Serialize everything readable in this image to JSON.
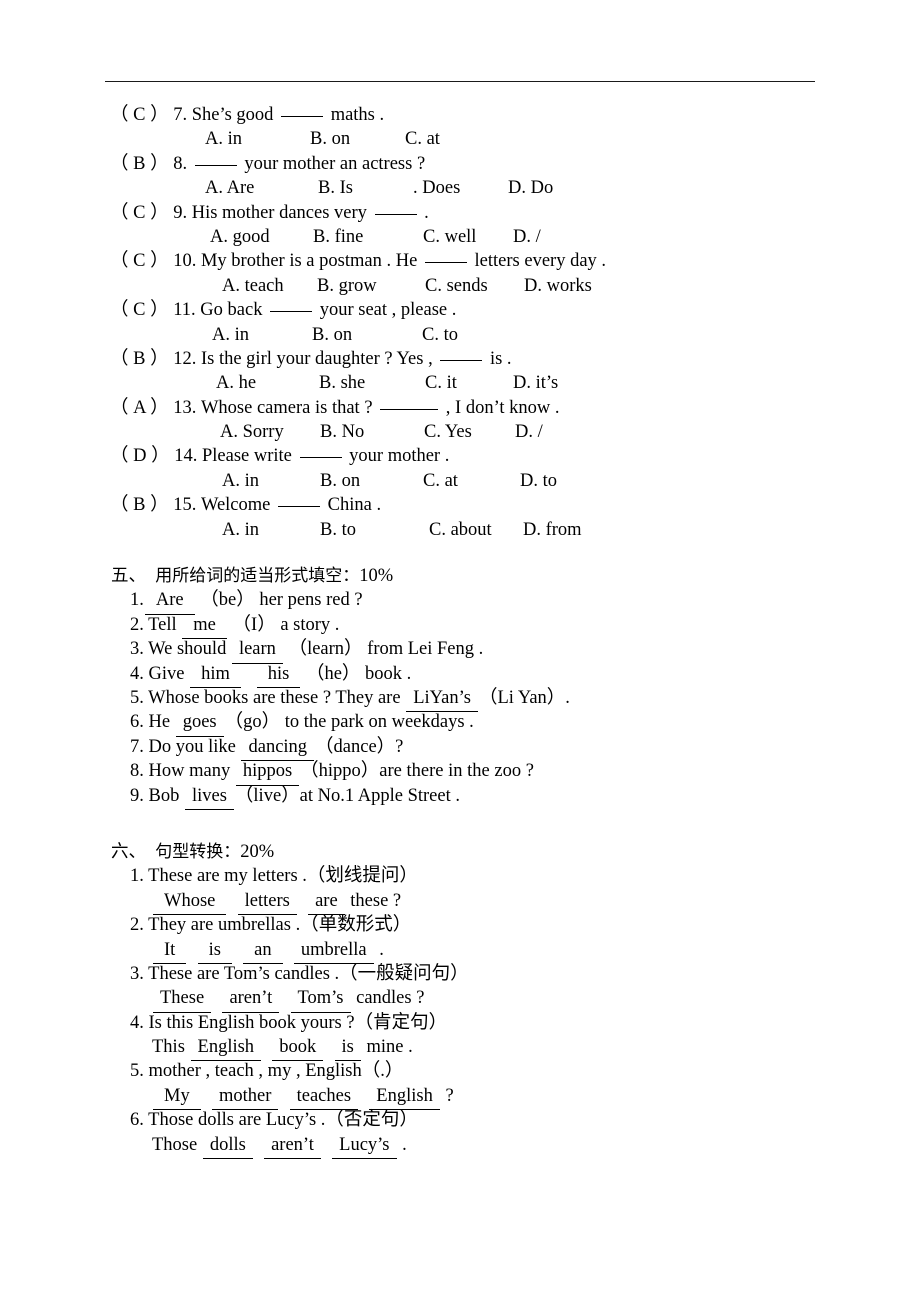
{
  "document": {
    "type": "english-exam-worksheet-page",
    "has_top_rule": true
  },
  "multiple_choice": {
    "questions": [
      {
        "key": "C",
        "number": "7.",
        "stem_before": "She’s good",
        "stem_after": "maths .",
        "blank_style": "short",
        "options": [
          "A. in",
          "B. on",
          "C. at"
        ],
        "option_x": [
          205,
          310,
          405
        ]
      },
      {
        "key": "B",
        "number": "8.",
        "stem_before": "",
        "stem_after": "your mother an actress ?",
        "blank_style": "short",
        "options": [
          "A. Are",
          "B. Is",
          ". Does",
          "D. Do"
        ],
        "option_x": [
          205,
          318,
          413,
          508
        ]
      },
      {
        "key": "C",
        "number": "9.",
        "stem_before": "His mother dances very",
        "stem_after": ".",
        "blank_style": "short",
        "options": [
          "A. good",
          "B. fine",
          "C. well",
          "D. /"
        ],
        "option_x": [
          210,
          313,
          423,
          513
        ]
      },
      {
        "key": "C",
        "number": "10.",
        "stem_before": "My brother is a postman . He",
        "stem_after": "letters every day .",
        "blank_style": "short",
        "options": [
          "A. teach",
          "B. grow",
          "C. sends",
          "D. works"
        ],
        "option_x": [
          222,
          317,
          425,
          524
        ]
      },
      {
        "key": "C",
        "number": "11.",
        "stem_before": "Go back",
        "stem_after": "your seat , please .",
        "blank_style": "short",
        "options": [
          "A. in",
          "B. on",
          "C. to"
        ],
        "option_x": [
          212,
          312,
          422
        ]
      },
      {
        "key": "B",
        "number": "12.",
        "stem_before": "Is the girl your daughter ? Yes ,",
        "stem_after": "is .",
        "blank_style": "short",
        "options": [
          "A. he",
          "B. she",
          "C. it",
          "D. it’s"
        ],
        "option_x": [
          216,
          319,
          425,
          513
        ]
      },
      {
        "key": "A",
        "number": "13.",
        "stem_before": "Whose camera is that ?",
        "stem_after": ", I don’t know .",
        "blank_style": "long",
        "options": [
          "A. Sorry",
          "B. No",
          "C. Yes",
          "D. /"
        ],
        "option_x": [
          220,
          320,
          424,
          515
        ]
      },
      {
        "key": "D",
        "number": "14.",
        "stem_before": "Please write",
        "stem_after": "your mother .",
        "blank_style": "short",
        "options": [
          "A. in",
          "B. on",
          "C. at",
          "D. to"
        ],
        "option_x": [
          222,
          320,
          423,
          520
        ]
      },
      {
        "key": "B",
        "number": "15.",
        "stem_before": "Welcome",
        "stem_after": "China .",
        "blank_style": "short",
        "options": [
          "A. in",
          "B. to",
          "C. about",
          "D. from"
        ],
        "option_x": [
          222,
          320,
          429,
          523
        ]
      }
    ]
  },
  "section_five": {
    "number": "五、",
    "title": "用所给词的适当形式填空：",
    "marks": "10%",
    "items": [
      {
        "number": "1.",
        "parts": [
          {
            "t": "fill",
            "v": "Are",
            "pad": "lg"
          },
          {
            "t": "text",
            "v": " （be） her pens red ?"
          }
        ]
      },
      {
        "number": "2.",
        "parts": [
          {
            "t": "text",
            "v": " Tell "
          },
          {
            "t": "fill",
            "v": "me",
            "pad": "lg"
          },
          {
            "t": "text",
            "v": " （I） a story ."
          }
        ]
      },
      {
        "number": "3.",
        "parts": [
          {
            "t": "text",
            "v": " We should "
          },
          {
            "t": "fill",
            "v": "learn",
            "pad": "sm"
          },
          {
            "t": "text",
            "v": " （learn） from Lei Feng ."
          }
        ]
      },
      {
        "number": "4.",
        "parts": [
          {
            "t": "text",
            "v": " Give "
          },
          {
            "t": "fill",
            "v": "him",
            "pad": "lg"
          },
          {
            "t": "text",
            "v": "   "
          },
          {
            "t": "fill",
            "v": "his",
            "pad": "lg"
          },
          {
            "t": "text",
            "v": " （he） book ."
          }
        ]
      },
      {
        "number": "5.",
        "parts": [
          {
            "t": "text",
            "v": " Whose books are these ? They are "
          },
          {
            "t": "fill",
            "v": "LiYan’s",
            "pad": "sm"
          },
          {
            "t": "text",
            "v": "（Li Yan）."
          }
        ]
      },
      {
        "number": "6.",
        "parts": [
          {
            "t": "text",
            "v": " He "
          },
          {
            "t": "fill",
            "v": "goes",
            "pad": "sm"
          },
          {
            "t": "text",
            "v": "（go） to the park on weekdays ."
          }
        ]
      },
      {
        "number": "7.",
        "parts": [
          {
            "t": "text",
            "v": " Do you like "
          },
          {
            "t": "fill",
            "v": "dancing",
            "pad": "sm"
          },
          {
            "t": "text",
            "v": "（dance）?"
          }
        ]
      },
      {
        "number": "8.",
        "parts": [
          {
            "t": "text",
            "v": " How many "
          },
          {
            "t": "fill",
            "v": "hippos",
            "pad": "sm"
          },
          {
            "t": "text",
            "v": "（hippo）are there in the zoo ?"
          }
        ]
      },
      {
        "number": "9.",
        "parts": [
          {
            "t": "text",
            "v": " Bob "
          },
          {
            "t": "fill",
            "v": "lives",
            "pad": "sm"
          },
          {
            "t": "text",
            "v": "（live）at No.1 Apple Street ."
          }
        ]
      }
    ]
  },
  "section_six": {
    "number": "六、",
    "title": "句型转换：",
    "marks": "20%",
    "items": [
      {
        "number": "1.",
        "prompt": " These are my letters .（划线提问）",
        "answer_parts": [
          {
            "t": "fill",
            "v": "Whose",
            "pad": "lg"
          },
          {
            "t": "text",
            "v": "  "
          },
          {
            "t": "fill",
            "v": "letters",
            "pad": "sm"
          },
          {
            "t": "text",
            "v": "  "
          },
          {
            "t": "fill",
            "v": "are",
            "pad": "sm"
          },
          {
            "t": "text",
            "v": " these ?"
          }
        ]
      },
      {
        "number": "2.",
        "prompt": " They are umbrellas .（单数形式）",
        "answer_parts": [
          {
            "t": "fill",
            "v": "It",
            "pad": "lg"
          },
          {
            "t": "text",
            "v": "  "
          },
          {
            "t": "fill",
            "v": "is",
            "pad": "lg"
          },
          {
            "t": "text",
            "v": "  "
          },
          {
            "t": "fill",
            "v": "an",
            "pad": "lg"
          },
          {
            "t": "text",
            "v": "  "
          },
          {
            "t": "fill",
            "v": "umbrella",
            "pad": "sm"
          },
          {
            "t": "text",
            "v": " ."
          }
        ]
      },
      {
        "number": "3.",
        "prompt": " These are Tom’s candles .（一般疑问句）",
        "answer_parts": [
          {
            "t": "fill",
            "v": "These",
            "pad": "sm"
          },
          {
            "t": "text",
            "v": "  "
          },
          {
            "t": "fill",
            "v": "aren’t",
            "pad": "sm"
          },
          {
            "t": "text",
            "v": "  "
          },
          {
            "t": "fill",
            "v": "Tom’s",
            "pad": "sm"
          },
          {
            "t": "text",
            "v": " candles ?"
          }
        ]
      },
      {
        "number": "4.",
        "prompt": " Is this English book yours ?（肯定句）",
        "answer_parts": [
          {
            "t": "text",
            "v": "This "
          },
          {
            "t": "fill",
            "v": "English",
            "pad": "sm"
          },
          {
            "t": "text",
            "v": "  "
          },
          {
            "t": "fill",
            "v": "book",
            "pad": "sm"
          },
          {
            "t": "text",
            "v": "  "
          },
          {
            "t": "fill",
            "v": "is",
            "pad": "sm"
          },
          {
            "t": "text",
            "v": " mine ."
          }
        ]
      },
      {
        "number": "5.",
        "prompt": " mother , teach , my , English（.）",
        "answer_parts": [
          {
            "t": "fill",
            "v": "My",
            "pad": "lg"
          },
          {
            "t": "text",
            "v": "  "
          },
          {
            "t": "fill",
            "v": "mother",
            "pad": "sm"
          },
          {
            "t": "text",
            "v": "  "
          },
          {
            "t": "fill",
            "v": "teaches",
            "pad": "sm"
          },
          {
            "t": "text",
            "v": "  "
          },
          {
            "t": "fill",
            "v": "English",
            "pad": "sm"
          },
          {
            "t": "text",
            "v": " ?"
          }
        ]
      },
      {
        "number": "6.",
        "prompt": " Those dolls are Lucy’s .（否定句）",
        "answer_parts": [
          {
            "t": "text",
            "v": "Those "
          },
          {
            "t": "fill",
            "v": "dolls",
            "pad": "sm"
          },
          {
            "t": "text",
            "v": "  "
          },
          {
            "t": "fill",
            "v": "aren’t",
            "pad": "sm"
          },
          {
            "t": "text",
            "v": "  "
          },
          {
            "t": "fill",
            "v": "Lucy’s",
            "pad": "sm"
          },
          {
            "t": "text",
            "v": " ."
          }
        ]
      }
    ]
  }
}
